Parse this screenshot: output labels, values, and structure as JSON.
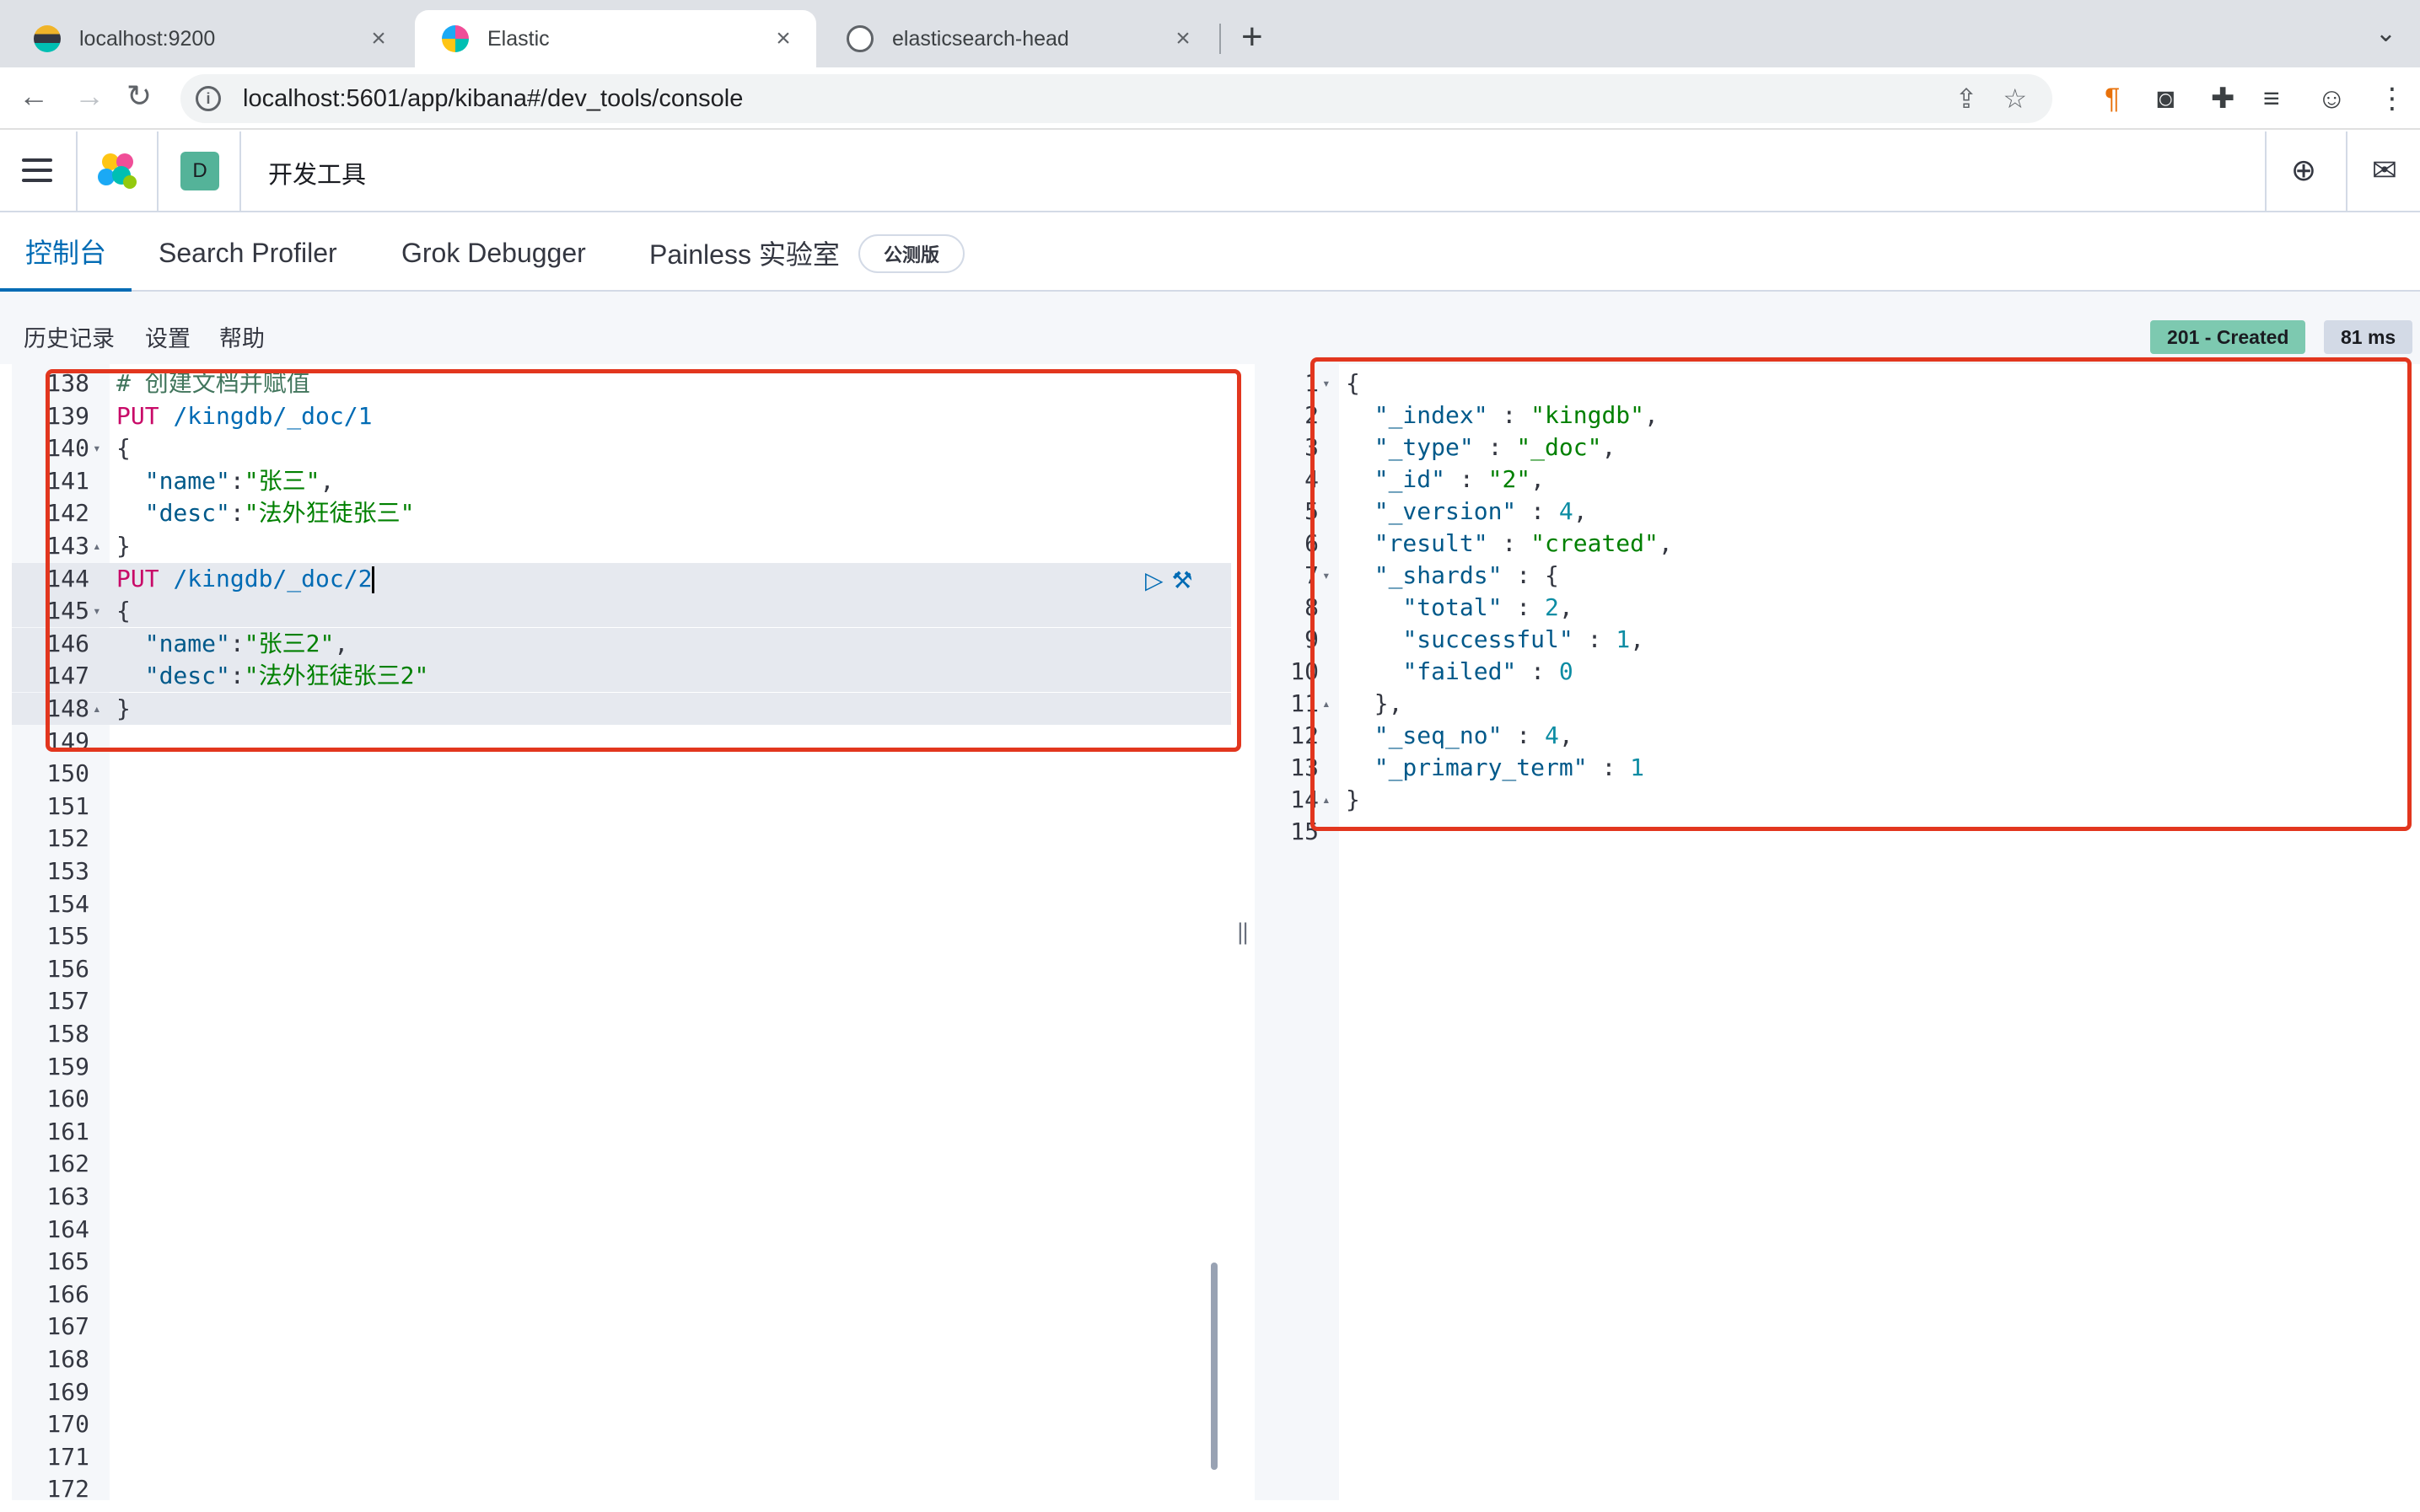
{
  "browser": {
    "tabs": [
      {
        "title": "localhost:9200",
        "active": false
      },
      {
        "title": "Elastic",
        "active": true
      },
      {
        "title": "elasticsearch-head",
        "active": false
      }
    ],
    "url": "localhost:5601/app/kibana#/dev_tools/console"
  },
  "header": {
    "space_initial": "D",
    "app_title": "开发工具"
  },
  "tabs": [
    {
      "label": "控制台",
      "active": true
    },
    {
      "label": "Search Profiler"
    },
    {
      "label": "Grok Debugger"
    },
    {
      "label": "Painless 实验室"
    }
  ],
  "beta_badge": "公测版",
  "menu": {
    "history": "历史记录",
    "settings": "设置",
    "help": "帮助"
  },
  "status": {
    "code": "201 - Created",
    "time": "81 ms",
    "code_color": "#7dc9b0",
    "time_color": "#d3dae6"
  },
  "editor": {
    "lines": [
      {
        "n": "138",
        "text": "# 创建文档并赋值"
      },
      {
        "n": "139",
        "text": "PUT /kingdb/_doc/1"
      },
      {
        "n": "140",
        "text": "{",
        "fold": "▾"
      },
      {
        "n": "141",
        "text": "  \"name\":\"张三\","
      },
      {
        "n": "142",
        "text": "  \"desc\":\"法外狂徒张三\""
      },
      {
        "n": "143",
        "text": "}",
        "fold": "▴"
      },
      {
        "n": "144",
        "text": "PUT /kingdb/_doc/2",
        "highlight": true
      },
      {
        "n": "145",
        "text": "{",
        "fold": "▾",
        "highlight": true
      },
      {
        "n": "146",
        "text": "  \"name\":\"张三2\",",
        "highlight": true
      },
      {
        "n": "147",
        "text": "  \"desc\":\"法外狂徒张三2\"",
        "highlight": true
      },
      {
        "n": "148",
        "text": "}",
        "fold": "▴",
        "highlight": true
      },
      {
        "n": "149",
        "text": ""
      },
      {
        "n": "150",
        "text": ""
      },
      {
        "n": "151",
        "text": ""
      },
      {
        "n": "152",
        "text": ""
      },
      {
        "n": "153",
        "text": ""
      },
      {
        "n": "154",
        "text": ""
      },
      {
        "n": "155",
        "text": ""
      },
      {
        "n": "156",
        "text": ""
      },
      {
        "n": "157",
        "text": ""
      },
      {
        "n": "158",
        "text": ""
      },
      {
        "n": "159",
        "text": ""
      },
      {
        "n": "160",
        "text": ""
      },
      {
        "n": "161",
        "text": ""
      },
      {
        "n": "162",
        "text": ""
      },
      {
        "n": "163",
        "text": ""
      },
      {
        "n": "164",
        "text": ""
      },
      {
        "n": "165",
        "text": ""
      },
      {
        "n": "166",
        "text": ""
      },
      {
        "n": "167",
        "text": ""
      },
      {
        "n": "168",
        "text": ""
      },
      {
        "n": "169",
        "text": ""
      },
      {
        "n": "170",
        "text": ""
      },
      {
        "n": "171",
        "text": ""
      },
      {
        "n": "172",
        "text": ""
      }
    ]
  },
  "output": {
    "lines": [
      {
        "n": "1",
        "text": "{",
        "fold": "▾"
      },
      {
        "n": "2",
        "text": "  \"_index\" : \"kingdb\","
      },
      {
        "n": "3",
        "text": "  \"_type\" : \"_doc\","
      },
      {
        "n": "4",
        "text": "  \"_id\" : \"2\","
      },
      {
        "n": "5",
        "text": "  \"_version\" : 4,"
      },
      {
        "n": "6",
        "text": "  \"result\" : \"created\","
      },
      {
        "n": "7",
        "text": "  \"_shards\" : {",
        "fold": "▾"
      },
      {
        "n": "8",
        "text": "    \"total\" : 2,"
      },
      {
        "n": "9",
        "text": "    \"successful\" : 1,"
      },
      {
        "n": "10",
        "text": "    \"failed\" : 0"
      },
      {
        "n": "11",
        "text": "  },",
        "fold": "▴"
      },
      {
        "n": "12",
        "text": "  \"_seq_no\" : 4,"
      },
      {
        "n": "13",
        "text": "  \"_primary_term\" : 1"
      },
      {
        "n": "14",
        "text": "}",
        "fold": "▴"
      },
      {
        "n": "15",
        "text": ""
      }
    ]
  }
}
